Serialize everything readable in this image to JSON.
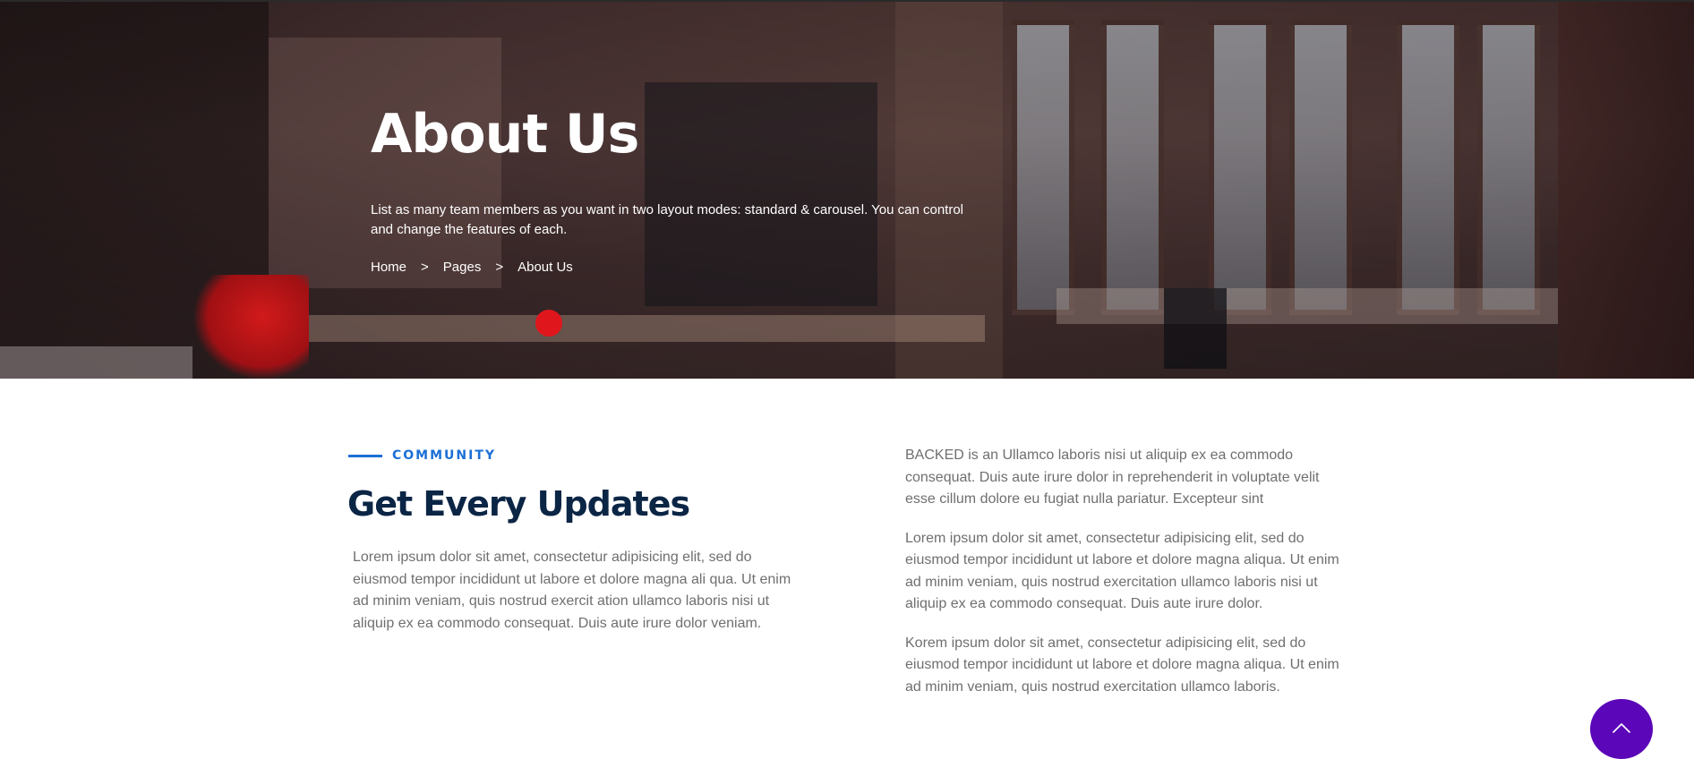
{
  "hero": {
    "title": "About Us",
    "description": "List as many team members as you want in two layout modes: standard & carousel. You can control and change the features of each.",
    "breadcrumb": {
      "home": "Home",
      "pages": "Pages",
      "current": "About Us",
      "separator": ">"
    }
  },
  "community": {
    "tag": "COMMUNITY",
    "title": "Get Every Updates",
    "paragraph": "Lorem ipsum dolor sit amet, consectetur adipisicing elit, sed do eiusmod tempor incididunt ut labore et dolore magna ali qua. Ut enim ad minim veniam, quis nostrud exercit ation ullamco laboris nisi ut aliquip ex ea commodo consequat. Duis aute irure dolor veniam."
  },
  "right_column": {
    "paragraphs": [
      "BACKED is an Ullamco laboris nisi ut aliquip ex ea commodo consequat. Duis aute irure dolor in reprehenderit in voluptate velit esse cillum dolore eu fugiat nulla pariatur. Excepteur sint",
      "Lorem ipsum dolor sit amet, consectetur adipisicing elit, sed do eiusmod tempor incididunt ut labore et dolore magna aliqua. Ut enim ad minim veniam, quis nostrud exercitation ullamco laboris nisi ut aliquip ex ea commodo consequat. Duis aute irure dolor.",
      "Korem ipsum dolor sit amet, consectetur adipisicing elit, sed do eiusmod tempor incididunt ut labore et dolore magna aliqua. Ut enim ad minim veniam, quis nostrud exercitation ullamco laboris."
    ]
  },
  "scroll_top": {
    "icon": "chevron-up-icon"
  },
  "colors": {
    "accent": "#1b6fd6",
    "heading": "#0b2545",
    "body_text": "#6f6f6f",
    "scroll_button": "#5b06b8",
    "hero_dot": "#e0161d"
  }
}
